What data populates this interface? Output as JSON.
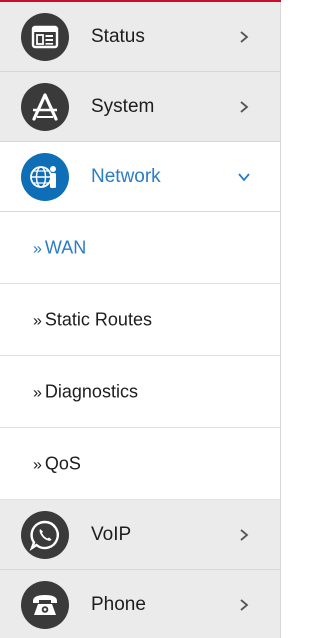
{
  "menu": {
    "status": {
      "label": "Status",
      "icon": "status-icon"
    },
    "system": {
      "label": "System",
      "icon": "system-icon"
    },
    "network": {
      "label": "Network",
      "icon": "network-icon",
      "expanded": true
    },
    "voip": {
      "label": "VoIP",
      "icon": "voip-icon"
    },
    "phone": {
      "label": "Phone",
      "icon": "phone-icon"
    }
  },
  "network_sub": {
    "marker": "»",
    "wan": "WAN",
    "static_routes": "Static Routes",
    "diagnostics": "Diagnostics",
    "qos": "QoS",
    "active": "WAN"
  },
  "colors": {
    "accent": "#2b7cc4",
    "icon_dark": "#3a3a3a",
    "icon_blue": "#0e6fb6",
    "item_bg": "#ebebeb"
  }
}
